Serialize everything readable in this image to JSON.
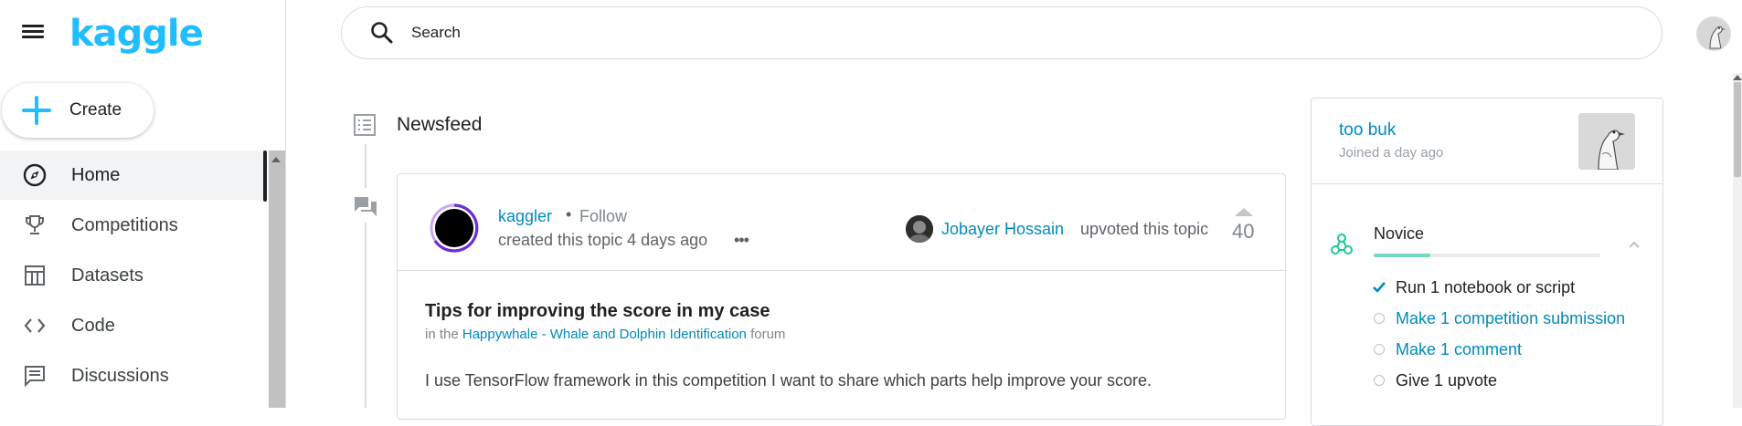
{
  "brand": {
    "logo_text": "kaggle",
    "accent_color": "#20beff",
    "link_color": "#008abc"
  },
  "sidebar": {
    "create_label": "Create",
    "items": [
      {
        "label": "Home",
        "icon": "compass-icon",
        "active": true
      },
      {
        "label": "Competitions",
        "icon": "trophy-icon",
        "active": false
      },
      {
        "label": "Datasets",
        "icon": "table-icon",
        "active": false
      },
      {
        "label": "Code",
        "icon": "code-icon",
        "active": false
      },
      {
        "label": "Discussions",
        "icon": "comments-icon",
        "active": false
      }
    ]
  },
  "search": {
    "placeholder": "Search"
  },
  "feed": {
    "title": "Newsfeed",
    "post": {
      "author": "kaggler",
      "follow_label": "Follow",
      "separator": "•",
      "created": "created this topic 4 days ago",
      "more": "•••",
      "upvoter": "Jobayer Hossain",
      "upvote_text": "upvoted this topic",
      "votes": "40",
      "title": "Tips for improving the score in my case",
      "in_the": "in the",
      "forum_name": "Happywhale - Whale and Dolphin Identification",
      "forum_suffix": "forum",
      "body": "I use TensorFlow framework in this competition I want to share which parts help improve your score."
    }
  },
  "profile": {
    "name": "too buk",
    "joined": "Joined a day ago",
    "tier": "Novice",
    "progress": 0.25,
    "tasks": [
      {
        "label": "Run 1 notebook or script",
        "done": true,
        "link": false
      },
      {
        "label": "Make 1 competition submission",
        "done": false,
        "link": true
      },
      {
        "label": "Make 1 comment",
        "done": false,
        "link": true
      },
      {
        "label": "Give 1 upvote",
        "done": false,
        "link": false
      }
    ]
  }
}
